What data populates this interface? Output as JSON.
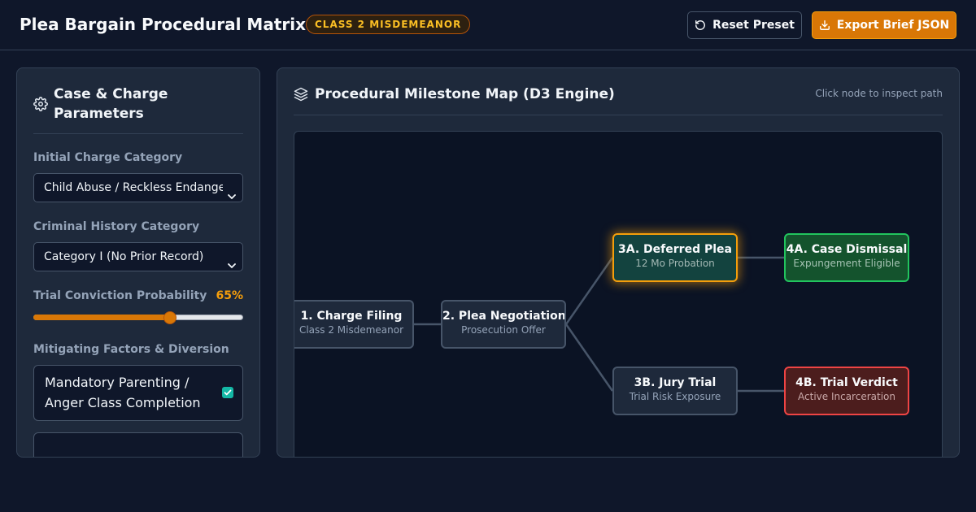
{
  "header": {
    "title": "Plea Bargain Procedural Matrix",
    "badge": "CLASS 2 MISDEMEANOR",
    "reset_label": "Reset Preset",
    "export_label": "Export Brief JSON"
  },
  "sidebar": {
    "title": "Case & Charge Parameters",
    "charge_label": "Initial Charge Category",
    "charge_value": "Child Abuse / Reckless Endangerment",
    "history_label": "Criminal History Category",
    "history_value": "Category I (No Prior Record)",
    "probability_label": "Trial Conviction Probability",
    "probability_text": "65%",
    "probability_value": 0.65,
    "mitigating_label": "Mitigating Factors & Diversion",
    "mitigating_option": "Mandatory Parenting / Anger Class Completion",
    "mitigating_checked": true
  },
  "map": {
    "title": "Procedural Milestone Map (D3 Engine)",
    "hint": "Click node to inspect path",
    "nodes": [
      {
        "id": "n1",
        "title": "1. Charge Filing",
        "subtitle": "Class 2 Misdemeanor",
        "status": "default"
      },
      {
        "id": "n2",
        "title": "2. Plea Negotiation",
        "subtitle": "Prosecution Offer",
        "status": "default"
      },
      {
        "id": "n3a",
        "title": "3A. Deferred Plea",
        "subtitle": "12 Mo Probation",
        "status": "selected"
      },
      {
        "id": "n3b",
        "title": "3B. Jury Trial",
        "subtitle": "Trial Risk Exposure",
        "status": "default"
      },
      {
        "id": "n4a",
        "title": "4A. Case Dismissal",
        "subtitle": "Expungement Eligible",
        "status": "positive"
      },
      {
        "id": "n4b",
        "title": "4B. Trial Verdict",
        "subtitle": "Active Incarceration",
        "status": "negative"
      }
    ],
    "edges": [
      [
        "n1",
        "n2"
      ],
      [
        "n2",
        "n3a"
      ],
      [
        "n2",
        "n3b"
      ],
      [
        "n3a",
        "n4a"
      ],
      [
        "n3b",
        "n4b"
      ]
    ]
  },
  "colors": {
    "accent": "#d97706",
    "selected_border": "#f59e0b",
    "positive": "#22c55e",
    "negative": "#ef4444",
    "edge": "#475569"
  },
  "icons": {
    "reset": "rotate-ccw-icon",
    "export": "download-icon",
    "settings": "gear-icon",
    "map": "layers-icon"
  }
}
